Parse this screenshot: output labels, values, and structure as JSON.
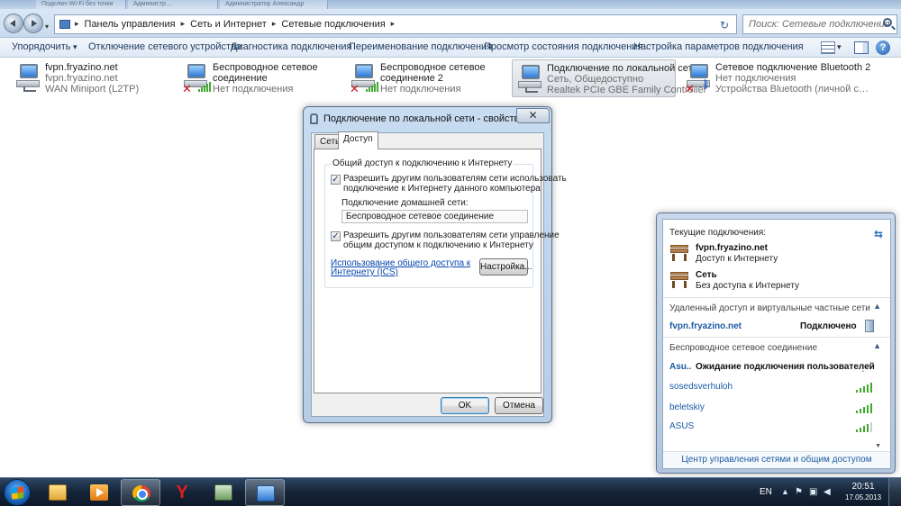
{
  "title_strip": {
    "tabs": [
      "Подключ Wi-Fi без точки",
      "Администр…",
      "Администратор Александр"
    ]
  },
  "address_bar": {
    "crumbs": [
      "Панель управления",
      "Сеть и Интернет",
      "Сетевые подключения"
    ],
    "search_placeholder": "Поиск: Сетевые подключения"
  },
  "command_bar": {
    "organize": "Упорядочить",
    "disable": "Отключение сетевого устройства",
    "diagnose": "Диагностика подключения",
    "rename": "Переименование подключения",
    "status": "Просмотр состояния подключения",
    "settings": "Настройка параметров подключения"
  },
  "connections": [
    {
      "name": "fvpn.fryazino.net",
      "line2": "fvpn.fryazino.net",
      "line3": "WAN Miniport (L2TP)",
      "icon": "pc-network-icon"
    },
    {
      "name": "Беспроводное сетевое",
      "line2": "соединение",
      "line3": "Нет подключения",
      "icon": "wireless-icon",
      "status_color": "#d01818"
    },
    {
      "name": "Беспроводное сетевое",
      "line2": "соединение 2",
      "line3": "Нет подключения",
      "icon": "wireless-icon",
      "status_color": "#d01818"
    },
    {
      "name": "Подключение по локальной сети",
      "line2": "Сеть, Общедоступно",
      "line3": "Realtek PCIe GBE Family Controller",
      "icon": "lan-icon",
      "selected": true
    },
    {
      "name": "Сетевое подключение Bluetooth 2",
      "line2": "Нет подключения",
      "line3": "Устройства Bluetooth (личной с…",
      "icon": "bluetooth-icon",
      "status_color": "#d01818"
    }
  ],
  "dialog": {
    "title": "Подключение по локальной сети - свойства",
    "close": "✕",
    "tabs": [
      "Сеть",
      "Доступ"
    ],
    "group_label": "Общий доступ к подключению к Интернету",
    "cb1_line1": "Разрешить другим пользователям сети использовать",
    "cb1_line2": "подключение к Интернету данного компьютера",
    "home_label": "Подключение домашней сети:",
    "home_value": "Беспроводное сетевое соединение",
    "cb2_line1": "Разрешить другим пользователям сети управление",
    "cb2_line2": "общим доступом к подключению к Интернету",
    "link_line1": "Использование общего доступа к",
    "link_line2": "Интернету (ICS)",
    "settings_btn": "Настройка...",
    "ok": "OK",
    "cancel": "Отмена",
    "cb1_checked": true,
    "cb2_checked": true
  },
  "flyout": {
    "header": "Текущие подключения:",
    "current": [
      {
        "name": "fvpn.fryazino.net",
        "status": "Доступ к Интернету"
      },
      {
        "name": "Сеть",
        "status": "Без доступа к Интернету"
      }
    ],
    "vpn_section": "Удаленный доступ и виртуальные частные сети",
    "vpn": {
      "name": "fvpn.fryazino.net",
      "status": "Подключено"
    },
    "wifi_section": "Беспроводное сетевое соединение",
    "adhoc": {
      "name": "Asu..",
      "status": "Ожидание подключения пользователей"
    },
    "wifi": [
      {
        "name": "sosedsverhuloh",
        "bars": 5
      },
      {
        "name": "beletskiy",
        "bars": 5
      },
      {
        "name": "ASUS",
        "bars": 4
      }
    ],
    "footer": "Центр управления сетями и общим доступом"
  },
  "taskbar": {
    "apps": [
      "explorer-icon",
      "media-player-icon",
      "chrome-icon",
      "yandex-browser-icon",
      "terminal-icon",
      "network-connections-icon"
    ],
    "lang": "EN",
    "time": "20:51",
    "date": "17.05.2013"
  }
}
